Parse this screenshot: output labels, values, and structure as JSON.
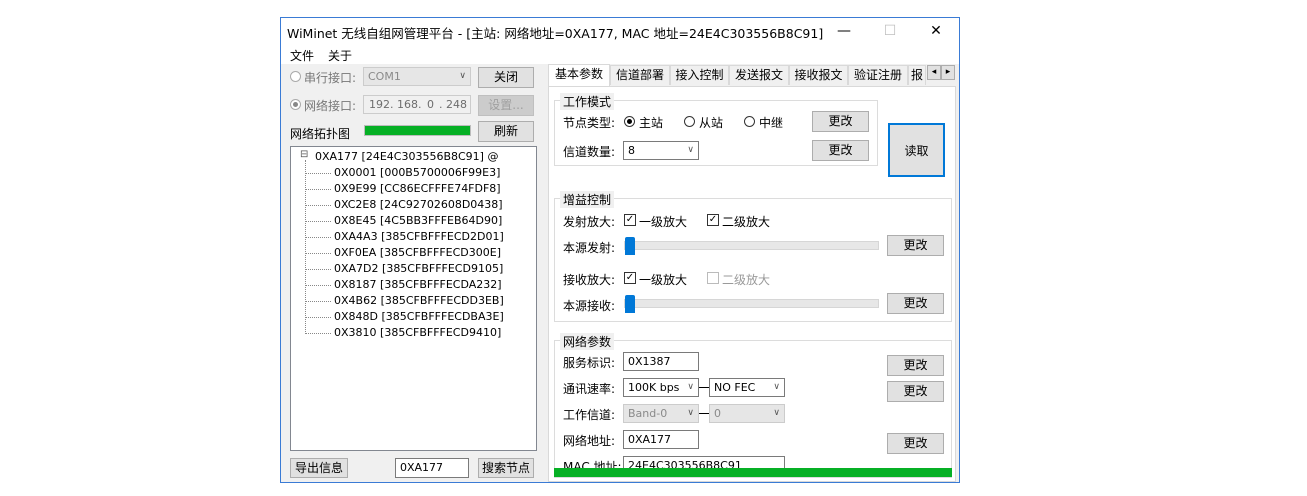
{
  "window": {
    "title": "WiMinet 无线自组网管理平台 - [主站: 网络地址=0XA177, MAC 地址=24E4C303556B8C91]",
    "controls": {
      "minimize": "—",
      "maximize": "☐",
      "close": "✕"
    }
  },
  "menu": {
    "file": "文件",
    "about": "关于"
  },
  "left": {
    "serial_label": "串行接口:",
    "serial_port": "COM1",
    "close_button": "关闭",
    "network_label": "网络接口:",
    "ip": {
      "a": "192",
      "b": "168",
      "c": "0",
      "d": "248"
    },
    "settings_button": "设置...",
    "topology_label": "网络拓扑图",
    "topology_progress": 1.0,
    "refresh_button": "刷新",
    "tree": {
      "root": "0XA177 [24E4C303556B8C91] @",
      "collapse_glyph": "⊟",
      "children": [
        "0X0001 [000B5700006F99E3]",
        "0X9E99 [CC86ECFFFE74FDF8]",
        "0XC2E8 [24C92702608D0438]",
        "0X8E45 [4C5BB3FFFEB64D90]",
        "0XA4A3 [385CFBFFFECD2D01]",
        "0XF0EA [385CFBFFFECD300E]",
        "0XA7D2 [385CFBFFFECD9105]",
        "0X8187 [385CFBFFFECDA232]",
        "0X4B62 [385CFBFFFECDD3EB]",
        "0X848D [385CFBFFFECDBA3E]",
        "0X3810 [385CFBFFFECD9410]"
      ]
    },
    "export_button": "导出信息",
    "search_value": "0XA177",
    "search_button": "搜索节点"
  },
  "tabs": [
    "基本参数",
    "信道部署",
    "接入控制",
    "发送报文",
    "接收报文",
    "验证注册",
    "报"
  ],
  "tab_scroll": {
    "left": "◂",
    "right": "▸"
  },
  "work_mode": {
    "title": "工作模式",
    "node_type_label": "节点类型:",
    "options": [
      "主站",
      "从站",
      "中继"
    ],
    "selected": "主站",
    "channels_label": "信道数量:",
    "channels_value": "8",
    "change1": "更改",
    "change2": "更改"
  },
  "read_button": "读取",
  "gain": {
    "title": "增益控制",
    "tx_label": "发射放大:",
    "tx_opt1": "一级放大",
    "tx_opt2": "二级放大",
    "tx_source_label": "本源发射:",
    "tx_level": 0,
    "tx_change": "更改",
    "rx_label": "接收放大:",
    "rx_opt1": "一级放大",
    "rx_opt2": "二级放大",
    "rx_source_label": "本源接收:",
    "rx_level": 0,
    "rx_change": "更改",
    "check_glyph": "✓"
  },
  "network": {
    "title": "网络参数",
    "service_label": "服务标识:",
    "service_value": "0X1387",
    "service_change": "更改",
    "rate_label": "通讯速率:",
    "rate_value": "100K bps",
    "fec_value": "NO FEC",
    "rate_change": "更改",
    "channel_label": "工作信道:",
    "band_value": "Band-0",
    "channel_value": "0",
    "address_label": "网络地址:",
    "address_value": "0XA177",
    "address_change": "更改",
    "mac_label": "MAC 地址:",
    "mac_value": "24E4C303556B8C91"
  },
  "bottom_progress": 1.0,
  "colors": {
    "progress": "#06b025",
    "slider_thumb": "#0078d7",
    "window_border": "#3a7bd5"
  }
}
